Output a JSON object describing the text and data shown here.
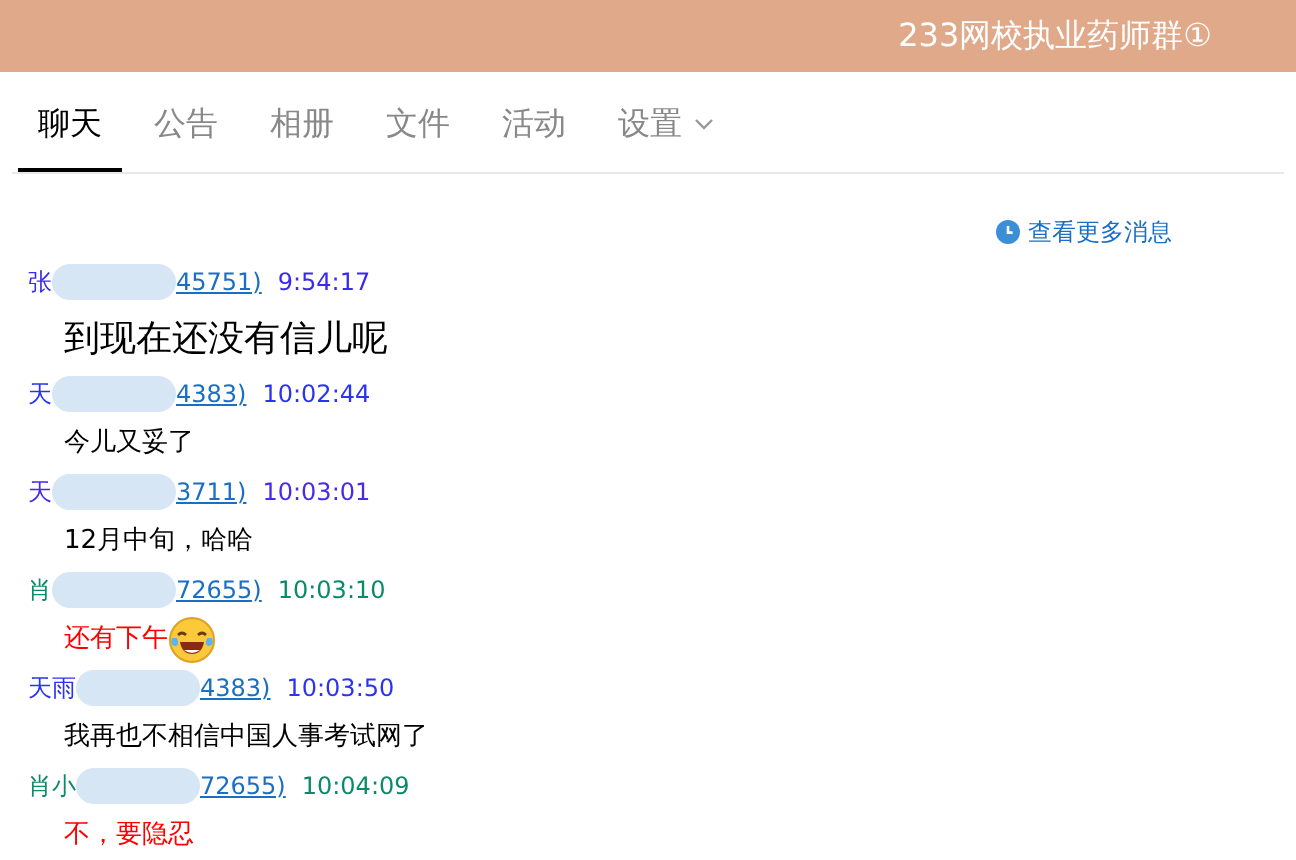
{
  "window": {
    "title": "233网校执业药师群①"
  },
  "tabs": [
    {
      "label": "聊天",
      "selected": true
    },
    {
      "label": "公告",
      "selected": false
    },
    {
      "label": "相册",
      "selected": false
    },
    {
      "label": "文件",
      "selected": false
    },
    {
      "label": "活动",
      "selected": false
    },
    {
      "label": "设置",
      "selected": false,
      "dropdown": true
    }
  ],
  "more_link": "查看更多消息",
  "messages": [
    {
      "name": "张",
      "id": "45751)",
      "time": "9:54:17",
      "color": "#3a2af0",
      "text": "到现在还没有信儿呢",
      "kind": "large"
    },
    {
      "name": "天",
      "id": "4383)",
      "time": "10:02:44",
      "color": "#2a34f0",
      "text": "今儿又妥了",
      "kind": "plain"
    },
    {
      "name": "天",
      "id": "3711)",
      "time": "10:03:01",
      "color": "#4a2ae8",
      "text": "12月中旬，哈哈",
      "kind": "plain"
    },
    {
      "name": "肖",
      "id": "72655)",
      "time": "10:03:10",
      "color": "#0a8a6a",
      "text": "还有下午",
      "kind": "red",
      "emoji": true
    },
    {
      "name": "天雨",
      "id": "4383)",
      "time": "10:03:50",
      "color": "#2a34f0",
      "text": "我再也不相信中国人事考试网了",
      "kind": "plain"
    },
    {
      "name": "肖小",
      "id": "72655)",
      "time": "10:04:09",
      "color": "#0a8a6a",
      "text": "不，要隐忍",
      "kind": "red"
    }
  ]
}
